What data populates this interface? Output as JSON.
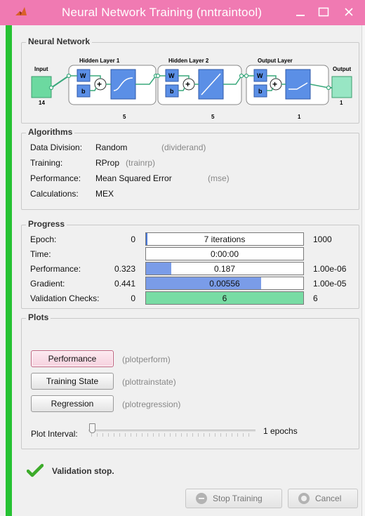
{
  "window": {
    "title": "Neural Network Training (nntraintool)"
  },
  "network": {
    "panel_title": "Neural Network",
    "input_label": "Input",
    "input_size": "14",
    "hidden1_label": "Hidden Layer 1",
    "hidden1_size": "5",
    "hidden2_label": "Hidden Layer 2",
    "hidden2_size": "5",
    "output_layer_label": "Output Layer",
    "output_layer_size": "1",
    "output_label": "Output",
    "output_size": "1",
    "w": "W",
    "b": "b",
    "plus": "+"
  },
  "algorithms": {
    "panel_title": "Algorithms",
    "rows": [
      {
        "label": "Data Division:",
        "value": "Random",
        "fn": "(dividerand)"
      },
      {
        "label": "Training:",
        "value": "RProp",
        "fn": "(trainrp)"
      },
      {
        "label": "Performance:",
        "value": "Mean Squared Error",
        "fn": "(mse)"
      },
      {
        "label": "Calculations:",
        "value": "MEX",
        "fn": ""
      }
    ]
  },
  "progress": {
    "panel_title": "Progress",
    "rows": [
      {
        "label": "Epoch:",
        "start": "0",
        "current": "7 iterations",
        "end": "1000",
        "fill": 0.007,
        "fill_color": "#4a78d6"
      },
      {
        "label": "Time:",
        "start": "",
        "current": "0:00:00",
        "end": "",
        "fill": 0,
        "fill_color": "#4a78d6"
      },
      {
        "label": "Performance:",
        "start": "0.323",
        "current": "0.187",
        "end": "1.00e-06",
        "fill": 0.16,
        "fill_color": "#7a9ce8"
      },
      {
        "label": "Gradient:",
        "start": "0.441",
        "current": "0.00556",
        "end": "1.00e-05",
        "fill": 0.73,
        "fill_color": "#7a9ce8"
      },
      {
        "label": "Validation Checks:",
        "start": "0",
        "current": "6",
        "end": "6",
        "fill": 1.0,
        "fill_color": "#78dca4"
      }
    ]
  },
  "plots": {
    "panel_title": "Plots",
    "buttons": [
      {
        "label": "Performance",
        "fn": "(plotperform)"
      },
      {
        "label": "Training State",
        "fn": "(plottrainstate)"
      },
      {
        "label": "Regression",
        "fn": "(plotregression)"
      }
    ],
    "interval_label": "Plot Interval:",
    "interval_value": "1 epochs",
    "interval_fraction": 0.0
  },
  "status": {
    "text": "Validation stop."
  },
  "buttons": {
    "stop": "Stop Training",
    "cancel": "Cancel"
  }
}
